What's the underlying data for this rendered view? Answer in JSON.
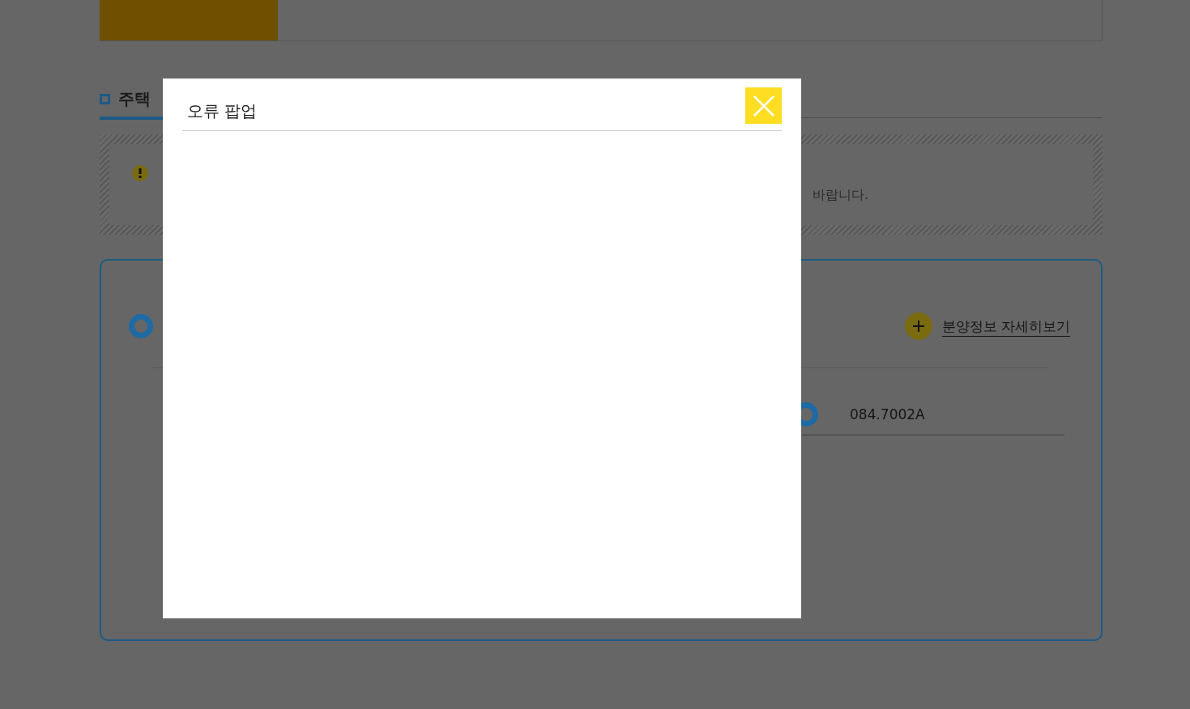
{
  "page": {
    "heading": "주택",
    "notice": "바랍니다.",
    "detail_link": "분양정보 자세히보기",
    "item_code": "084.7002A"
  },
  "modal": {
    "title": "오류 팝업"
  }
}
